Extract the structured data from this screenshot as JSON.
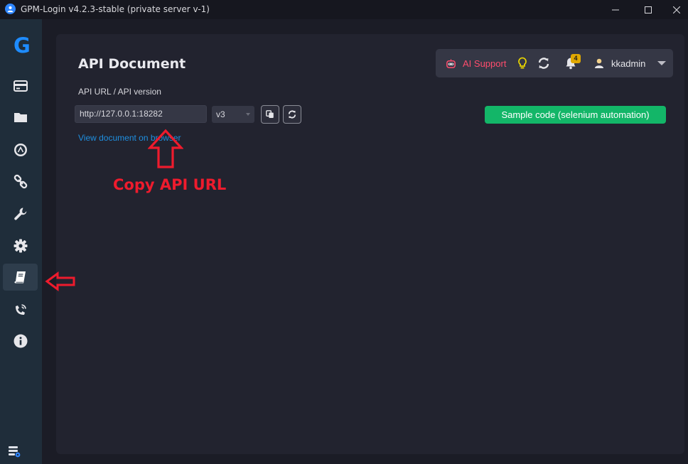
{
  "window": {
    "title": "GPM-Login v4.2.3-stable (private server v-1)",
    "controls": [
      "minimize",
      "maximize",
      "close"
    ]
  },
  "sidebar": {
    "logo": "G",
    "items": [
      {
        "icon": "credit-card-icon",
        "active": false
      },
      {
        "icon": "folder-icon",
        "active": false
      },
      {
        "icon": "circle-a-icon",
        "active": false
      },
      {
        "icon": "link-icon",
        "active": false
      },
      {
        "icon": "wrench-icon",
        "active": false
      },
      {
        "icon": "gear-icon",
        "active": false
      },
      {
        "icon": "book-icon",
        "active": true
      },
      {
        "icon": "phone-signal-icon",
        "active": false
      },
      {
        "icon": "info-icon",
        "active": false
      }
    ],
    "bottom_icon": "database-settings-icon"
  },
  "main": {
    "title": "API Document",
    "topbar": {
      "ai_support": "AI Support",
      "notification_count": "4",
      "username": "kkadmin"
    },
    "api_label": "API URL / API version",
    "url_value": "http://127.0.0.1:18282",
    "version": "v3",
    "sample_button": "Sample code (selenium automation)",
    "view_document_link": "View document on browser"
  },
  "annotations": {
    "copy_label": "Copy API URL"
  },
  "colors": {
    "accent_blue": "#1e8cff",
    "sample_green": "#13b668",
    "ai_red": "#ff4d6d",
    "annotation_red": "#ee1b2d",
    "badge_yellow": "#e0a800"
  }
}
